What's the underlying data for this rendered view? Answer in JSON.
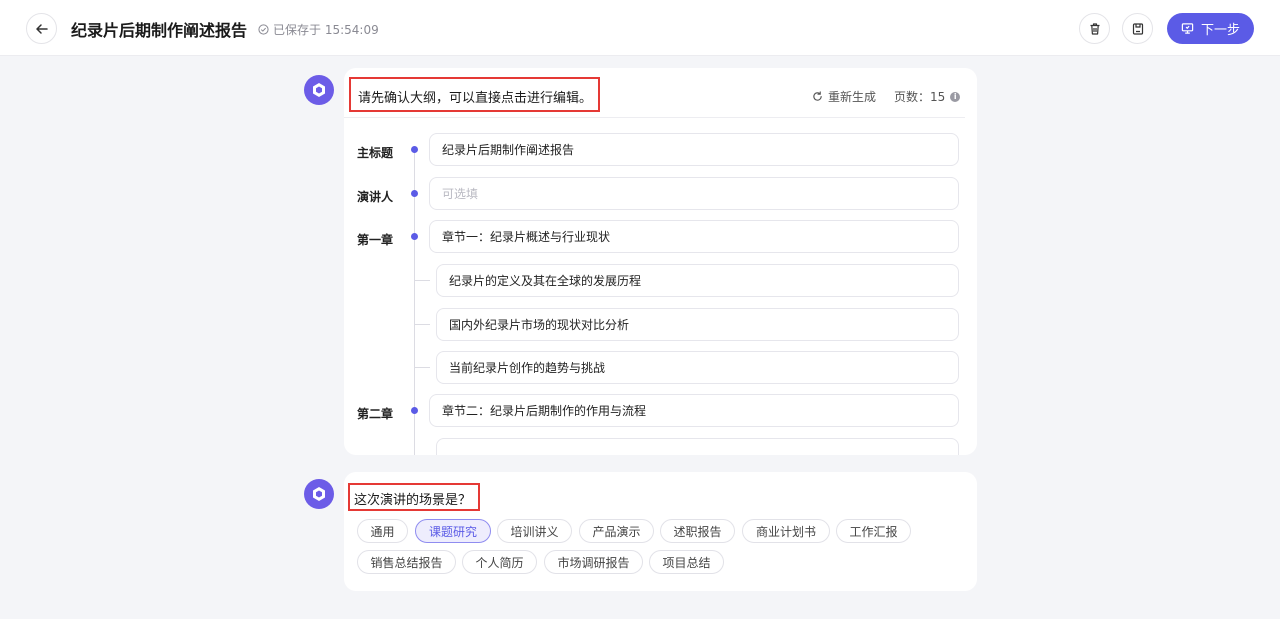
{
  "header": {
    "title": "纪录片后期制作阐述报告",
    "save_status": "已保存于 15:54:09",
    "next_label": "下一步"
  },
  "outline": {
    "prompt": "请先确认大纲，可以直接点击进行编辑。",
    "regenerate_label": "重新生成",
    "pages_label": "页数：15",
    "rows": {
      "main_title": {
        "label": "主标题",
        "value": "纪录片后期制作阐述报告"
      },
      "speaker": {
        "label": "演讲人",
        "placeholder": "可选填"
      },
      "chapter1": {
        "label": "第一章",
        "title": "章节一：纪录片概述与行业现状",
        "sections": [
          "纪录片的定义及其在全球的发展历程",
          "国内外纪录片市场的现状对比分析",
          "当前纪录片创作的趋势与挑战"
        ]
      },
      "chapter2": {
        "label": "第二章",
        "title": "章节二：纪录片后期制作的作用与流程"
      }
    }
  },
  "scene": {
    "prompt": "这次演讲的场景是？",
    "selected": "课题研究",
    "options": [
      "通用",
      "课题研究",
      "培训讲义",
      "产品演示",
      "述职报告",
      "商业计划书",
      "工作汇报",
      "销售总结报告",
      "个人简历",
      "市场调研报告",
      "项目总结"
    ]
  },
  "colors": {
    "accent": "#5b5be6",
    "highlight_box": "#e53935"
  },
  "icons": [
    "back-arrow-icon",
    "check-circle-icon",
    "trash-icon",
    "save-icon",
    "presentation-icon",
    "refresh-icon",
    "info-icon",
    "logo-icon"
  ]
}
